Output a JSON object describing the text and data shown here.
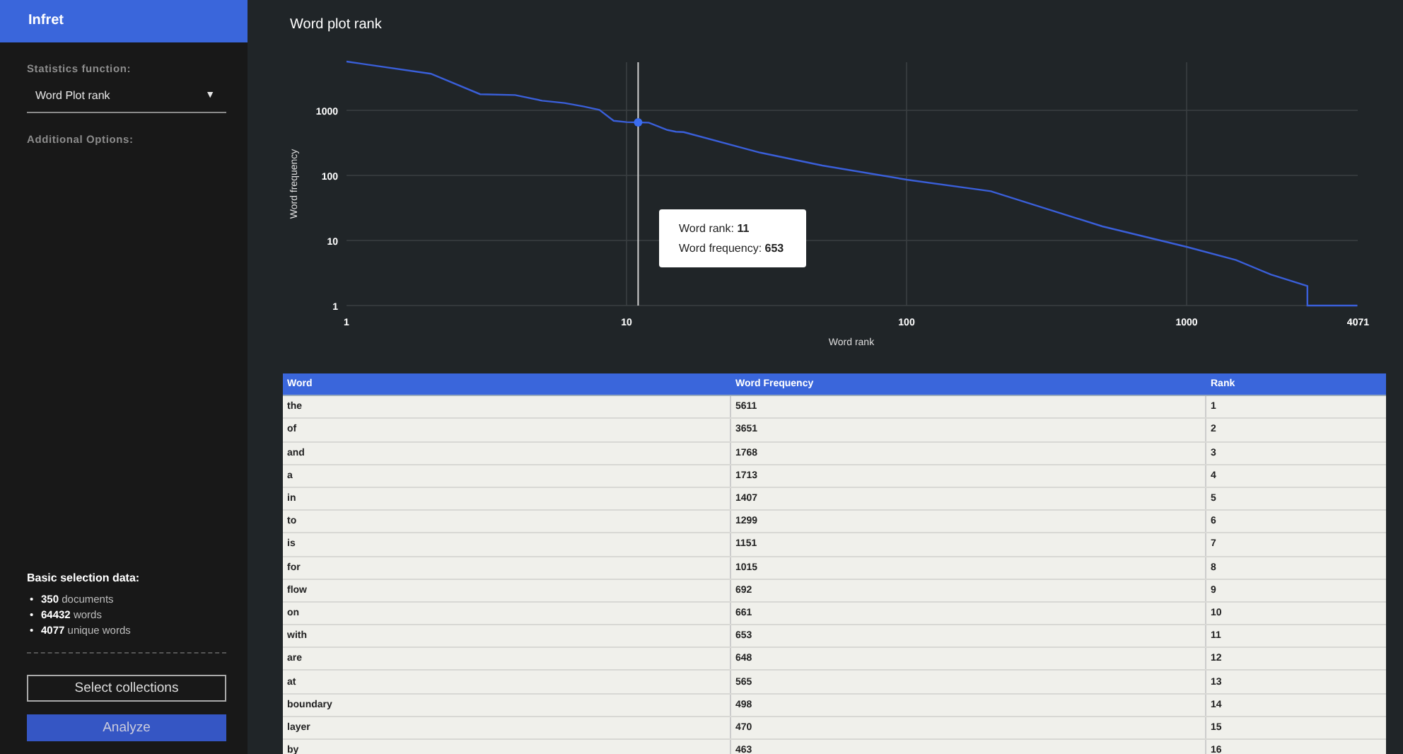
{
  "sidebar": {
    "app_title": "Infret",
    "statistics_label": "Statistics function:",
    "statistics_select": {
      "value": "Word Plot rank",
      "caret": "▼"
    },
    "options_label": "Additional Options:",
    "selection_title": "Basic selection data:",
    "selection_items": [
      {
        "bullet": "•",
        "text": "**350** documents"
      },
      {
        "bullet": "•",
        "text": "**64432** words"
      },
      {
        "bullet": "•",
        "text": "**4077** unique words"
      }
    ],
    "buttons": [
      {
        "label": "Select collections",
        "kind": "outline"
      },
      {
        "label": "Analyze",
        "kind": "primary"
      }
    ]
  },
  "chart": {
    "title": "Word plot rank",
    "xlabel": "Word rank",
    "ylabel": "Word frequency",
    "xticks": [
      "1",
      "10",
      "100",
      "1000",
      "4071"
    ],
    "yticks": [
      "1000",
      "100",
      "10",
      "1"
    ],
    "tooltip": [
      "Word rank: **11**",
      "Word frequency: **653**"
    ]
  },
  "table": {
    "columns": [
      "Word",
      "Word Frequency",
      "Rank"
    ],
    "rows": [
      [
        "the",
        "5611",
        "1"
      ],
      [
        "of",
        "3651",
        "2"
      ],
      [
        "and",
        "1768",
        "3"
      ],
      [
        "a",
        "1713",
        "4"
      ],
      [
        "in",
        "1407",
        "5"
      ],
      [
        "to",
        "1299",
        "6"
      ],
      [
        "is",
        "1151",
        "7"
      ],
      [
        "for",
        "1015",
        "8"
      ],
      [
        "flow",
        "692",
        "9"
      ],
      [
        "on",
        "661",
        "10"
      ],
      [
        "with",
        "653",
        "11"
      ],
      [
        "are",
        "648",
        "12"
      ],
      [
        "at",
        "565",
        "13"
      ],
      [
        "boundary",
        "498",
        "14"
      ],
      [
        "layer",
        "470",
        "15"
      ],
      [
        "by",
        "463",
        "16"
      ]
    ]
  }
}
